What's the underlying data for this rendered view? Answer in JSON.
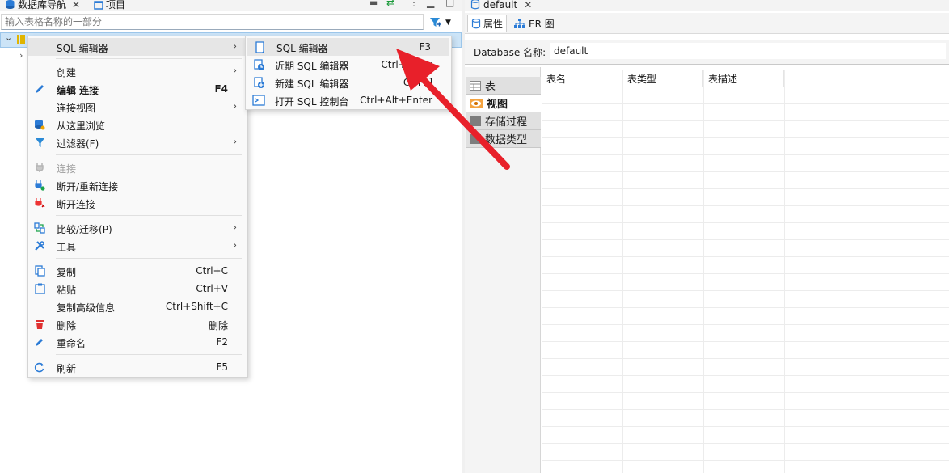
{
  "navigator": {
    "tab_label": "数据库导航",
    "projects_tab_label": "项目",
    "filter_placeholder": "输入表格名称的一部分"
  },
  "context_menu": {
    "items": [
      {
        "label": "SQL 编辑器",
        "shortcut": "",
        "submenu": true
      },
      {
        "label": "创建",
        "shortcut": "",
        "submenu": true
      },
      {
        "label": "编辑 连接",
        "shortcut": "F4",
        "submenu": false
      },
      {
        "label": "连接视图",
        "shortcut": "",
        "submenu": true
      },
      {
        "label": "从这里浏览",
        "shortcut": "",
        "submenu": false
      },
      {
        "label": "过滤器(F)",
        "shortcut": "",
        "submenu": true
      },
      {
        "label": "连接",
        "shortcut": "",
        "submenu": false
      },
      {
        "label": "断开/重新连接",
        "shortcut": "",
        "submenu": false
      },
      {
        "label": "断开连接",
        "shortcut": "",
        "submenu": false
      },
      {
        "label": "比较/迁移(P)",
        "shortcut": "",
        "submenu": true
      },
      {
        "label": "工具",
        "shortcut": "",
        "submenu": true
      },
      {
        "label": "复制",
        "shortcut": "Ctrl+C",
        "submenu": false
      },
      {
        "label": "粘贴",
        "shortcut": "Ctrl+V",
        "submenu": false
      },
      {
        "label": "复制高级信息",
        "shortcut": "Ctrl+Shift+C",
        "submenu": false
      },
      {
        "label": "删除",
        "shortcut": "删除",
        "submenu": false
      },
      {
        "label": "重命名",
        "shortcut": "F2",
        "submenu": false
      },
      {
        "label": "刷新",
        "shortcut": "F5",
        "submenu": false
      }
    ]
  },
  "submenu": {
    "items": [
      {
        "label": "SQL 编辑器",
        "shortcut": "F3"
      },
      {
        "label": "近期 SQL 编辑器",
        "shortcut": "Ctrl+Enter"
      },
      {
        "label": "新建 SQL 编辑器",
        "shortcut": "Ctrl+]"
      },
      {
        "label": "打开 SQL 控制台",
        "shortcut": "Ctrl+Alt+Enter"
      }
    ]
  },
  "editor": {
    "tab_label": "default",
    "subtabs": {
      "properties": "属性",
      "er": "ER 图"
    },
    "db_name_label": "Database 名称:",
    "db_name_value": "default",
    "object_types": [
      "表",
      "视图",
      "存储过程",
      "数据类型"
    ],
    "active_object_type": "视图",
    "columns": [
      "表名",
      "表类型",
      "表描述"
    ]
  },
  "colors": {
    "selection": "#cce4f7",
    "arrow": "#e8202a",
    "accent_blue": "#1a73c8"
  }
}
